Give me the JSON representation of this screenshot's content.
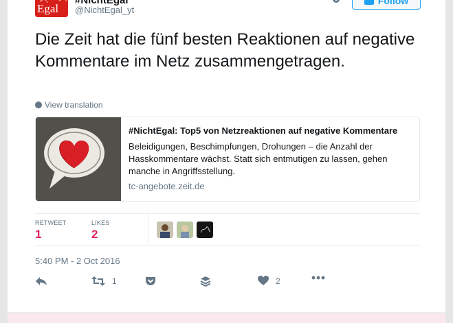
{
  "header": {
    "display_name": "#NichtEgal",
    "screen_name": "@NichtEgal_yt",
    "avatar_text": "Egal",
    "follow_label": "Follow"
  },
  "tweet": {
    "text": "Die Zeit hat die fünf besten Reaktionen auf negative Kommentare im Netz zusammengetragen.",
    "translate_label": "View translation"
  },
  "link_card": {
    "title": "#NichtEgal: Top5 von Netzreaktionen auf negative Kommentare",
    "description": "Beleidigungen, Beschimpfungen, Drohungen – die Anzahl der Hasskommentare wächst. Statt sich entmutigen zu lassen, gehen manche in Angriffsstellung.",
    "domain": "tc-angebote.zeit.de"
  },
  "stats": {
    "retweets_label": "RETWEET",
    "retweets_value": "1",
    "likes_label": "LIKES",
    "likes_value": "2"
  },
  "timestamp": "5:40 PM - 2 Oct 2016",
  "actions": {
    "retweet_count": "1",
    "like_count": "2"
  },
  "colors": {
    "accent": "#1da1f2",
    "like_red": "#e0245e",
    "muted": "#657786",
    "brand_red": "#d8201a"
  },
  "icons": [
    "gear-icon",
    "follow-person-icon",
    "globe-icon",
    "reply-icon",
    "retweet-icon",
    "pocket-icon",
    "buffer-icon",
    "heart-icon",
    "more-icon"
  ]
}
